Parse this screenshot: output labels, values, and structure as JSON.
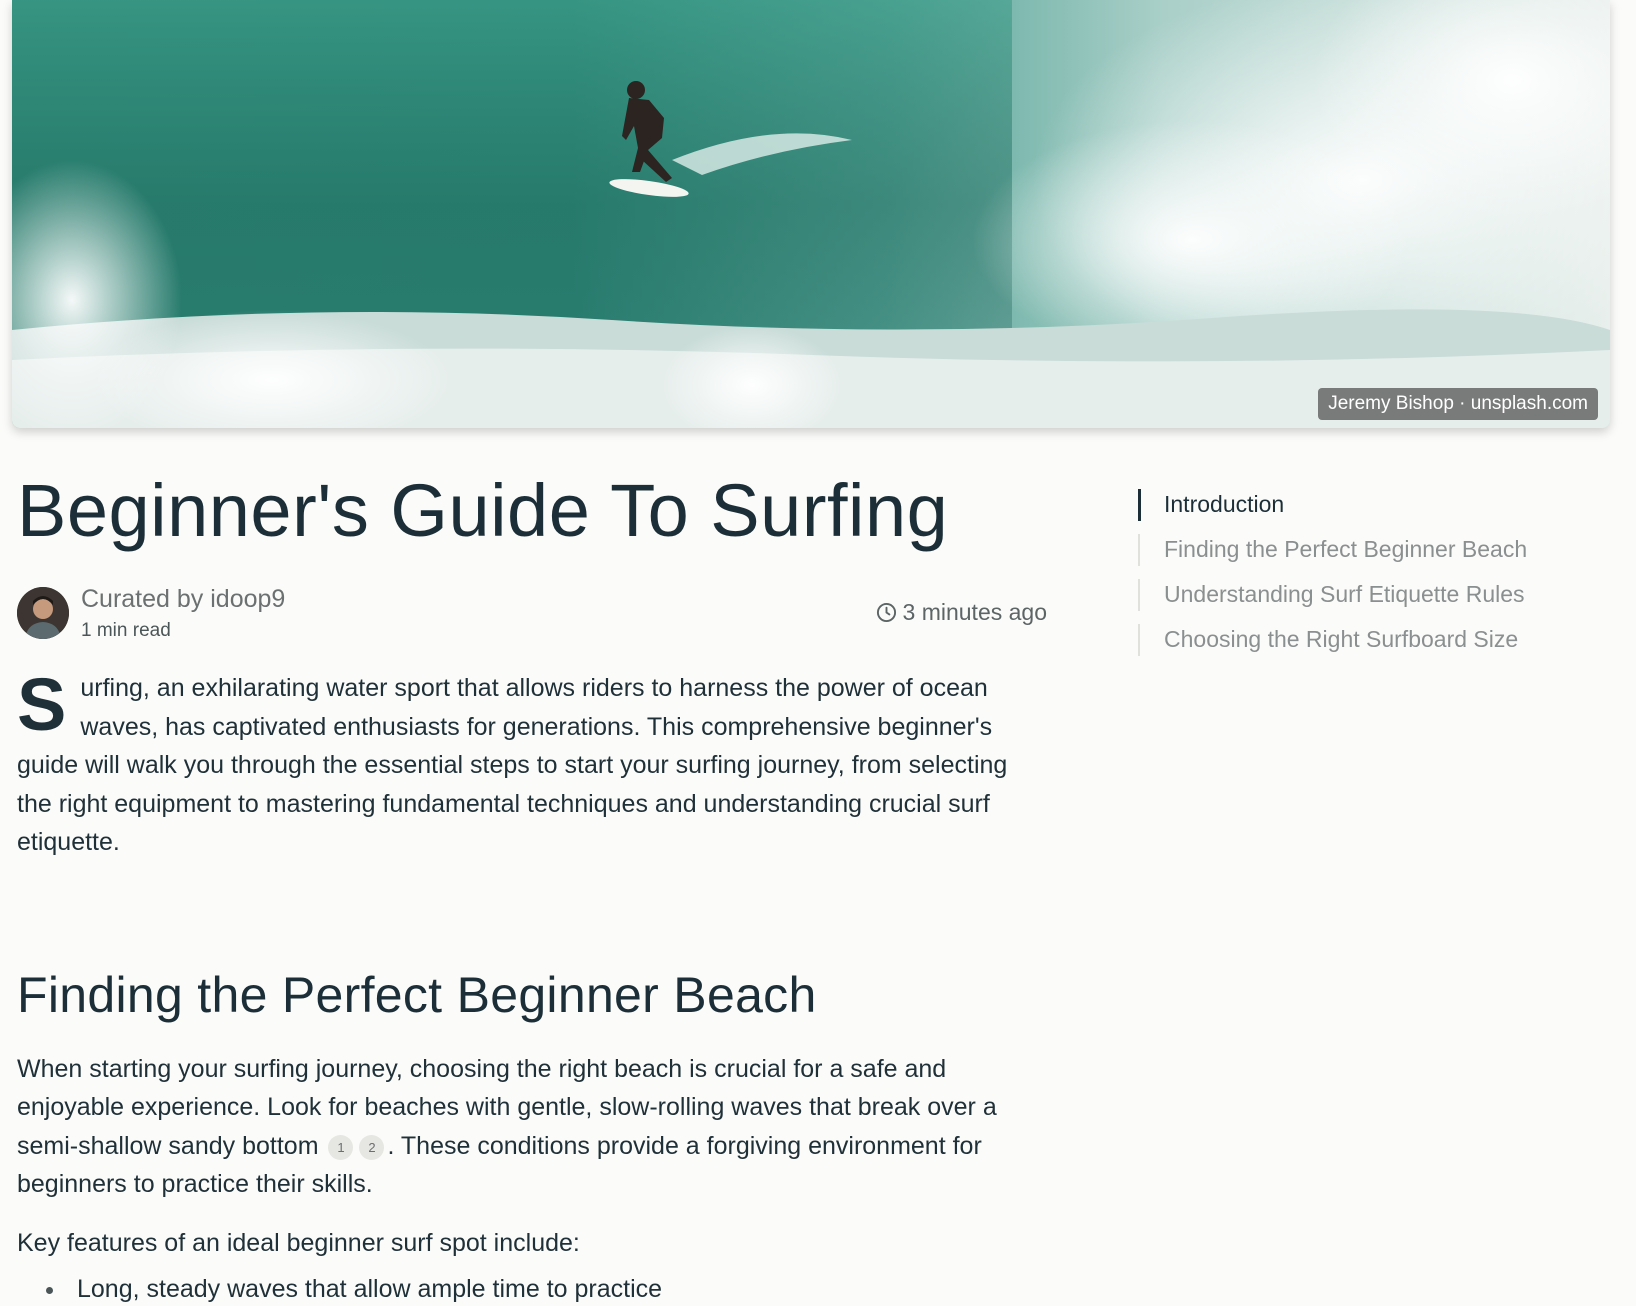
{
  "hero": {
    "credit": "Jeremy Bishop · unsplash.com"
  },
  "article": {
    "title": "Beginner's Guide To Surfing",
    "author": "Curated by idoop9",
    "read_time": "1 min read",
    "timestamp": "3 minutes ago",
    "intro_dropcap": "S",
    "intro_text": "urfing, an exhilarating water sport that allows riders to harness the power of ocean waves, has captivated enthusiasts for generations. This comprehensive beginner's guide will walk you through the essential steps to start your surfing journey, from selecting the right equipment to mastering fundamental techniques and understanding crucial surf etiquette.",
    "section1": {
      "heading": "Finding the Perfect Beginner Beach",
      "para_before": "When starting your surfing journey, choosing the right beach is crucial for a safe and enjoyable experience. Look for beaches with gentle, slow-rolling waves that break over a semi-shallow sandy bottom",
      "citations": [
        "1",
        "2"
      ],
      "para_after": ". These conditions provide a forgiving environment for beginners to practice their skills.",
      "list_intro": "Key features of an ideal beginner surf spot include:",
      "bullets": [
        "Long, steady waves that allow ample time to practice"
      ]
    }
  },
  "toc": {
    "items": [
      "Introduction",
      "Finding the Perfect Beginner Beach",
      "Understanding Surf Etiquette Rules",
      "Choosing the Right Surfboard Size"
    ],
    "active_index": 0
  }
}
